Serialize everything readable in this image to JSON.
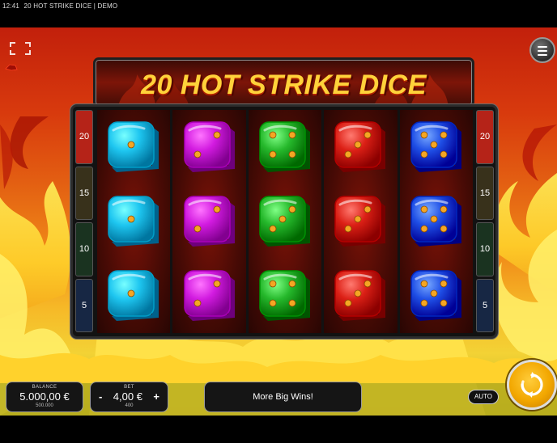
{
  "status_bar": {
    "time": "12:41",
    "title": "20 HOT STRIKE DICE | DEMO"
  },
  "game": {
    "title": "20 HOT STRIKE DICE",
    "paylines_left": [
      "20",
      "15",
      "10",
      "5"
    ],
    "paylines_right": [
      "20",
      "15",
      "10",
      "5"
    ],
    "reels": [
      {
        "color": "cyan",
        "hex": "#1ec6f0",
        "faces": [
          1,
          1,
          1
        ]
      },
      {
        "color": "magenta",
        "hex": "#d21be0",
        "faces": [
          2,
          2,
          2
        ]
      },
      {
        "color": "green",
        "hex": "#26b92c",
        "faces": [
          4,
          3,
          4
        ]
      },
      {
        "color": "red",
        "hex": "#dc2016",
        "faces": [
          3,
          3,
          3
        ]
      },
      {
        "color": "blue",
        "hex": "#1f4fe6",
        "faces": [
          5,
          5,
          5
        ]
      }
    ]
  },
  "footer": {
    "balance_label": "BALANCE",
    "balance_value": "5.000,00 €",
    "balance_sub": "500.000",
    "bet_label": "BET",
    "bet_minus": "-",
    "bet_value": "4,00 €",
    "bet_plus": "+",
    "bet_sub": "400",
    "message": "More Big Wins!",
    "auto_label": "AUTO"
  },
  "icons": {
    "fullscreen": "fullscreen-icon",
    "menu": "menu-icon",
    "spin": "spin-icon"
  },
  "colors": {
    "accent": "#f2a700",
    "title": "#ffd23a",
    "frame": "#2c2c2c"
  }
}
